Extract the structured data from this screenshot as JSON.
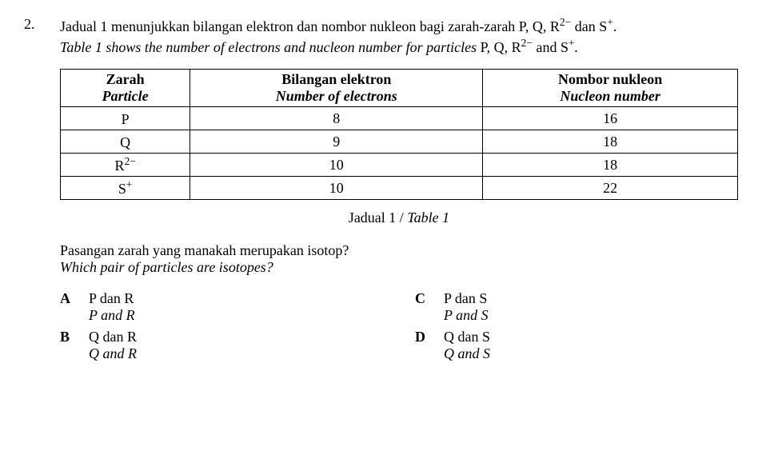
{
  "question": {
    "number": "2.",
    "stem_ms_parts": [
      "Jadual 1 menunjukkan bilangan elektron dan nombor nukleon bagi zarah-zarah P, Q, R",
      "2−",
      " dan S",
      "+",
      "."
    ],
    "stem_en_parts": [
      "Table 1 shows the number of electrons and nucleon number for particles ",
      "P, Q, R",
      "2−",
      " and S",
      "+",
      "."
    ],
    "table": {
      "headers": [
        {
          "ms": "Zarah",
          "en": "Particle"
        },
        {
          "ms": "Bilangan elektron",
          "en": "Number of electrons"
        },
        {
          "ms": "Nombor nukleon",
          "en": "Nucleon number"
        }
      ],
      "rows": [
        {
          "particle_base": "P",
          "particle_sup": "",
          "electrons": "8",
          "nucleon": "16"
        },
        {
          "particle_base": "Q",
          "particle_sup": "",
          "electrons": "9",
          "nucleon": "18"
        },
        {
          "particle_base": "R",
          "particle_sup": "2−",
          "electrons": "10",
          "nucleon": "18"
        },
        {
          "particle_base": "S",
          "particle_sup": "+",
          "electrons": "10",
          "nucleon": "22"
        }
      ]
    },
    "caption": {
      "ms": "Jadual 1",
      "sep": " / ",
      "en": "Table 1"
    },
    "ask_ms": "Pasangan zarah yang manakah merupakan isotop?",
    "ask_en": "Which pair of particles are isotopes?",
    "options": [
      {
        "label": "A",
        "ms": "P dan R",
        "en": "P and R"
      },
      {
        "label": "B",
        "ms": "Q dan R",
        "en": "Q and R"
      },
      {
        "label": "C",
        "ms": "P dan S",
        "en": "P and S"
      },
      {
        "label": "D",
        "ms": "Q dan S",
        "en": "Q and S"
      }
    ]
  }
}
